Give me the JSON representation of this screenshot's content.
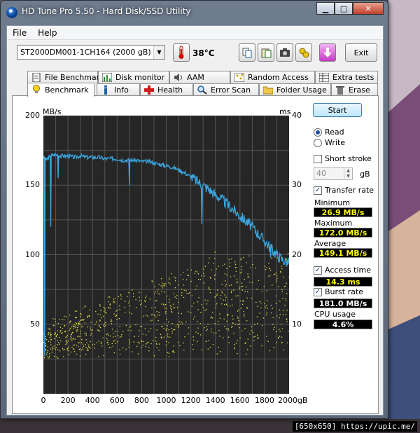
{
  "window": {
    "title": "HD Tune Pro 5.50 - Hard Disk/SSD Utility",
    "buttons": {
      "minimize": "▁",
      "maximize": "□",
      "close": "✕"
    }
  },
  "menu": {
    "file": "File",
    "help": "Help"
  },
  "toolbar": {
    "drive": "ST2000DM001-1CH164 (2000 gB)",
    "temperature": "38°C",
    "exit": "Exit"
  },
  "tabs_top": [
    "File Benchmark",
    "Disk monitor",
    "AAM",
    "Random Access",
    "Extra tests"
  ],
  "tabs_bottom": [
    "Benchmark",
    "Info",
    "Health",
    "Error Scan",
    "Folder Usage",
    "Erase"
  ],
  "side": {
    "start": "Start",
    "read": "Read",
    "write": "Write",
    "short_stroke": "Short stroke",
    "short_stroke_value": "40",
    "short_stroke_unit": "gB",
    "transfer_rate": "Transfer rate",
    "minimum_label": "Minimum",
    "minimum": "26.9 MB/s",
    "maximum_label": "Maximum",
    "maximum": "172.0 MB/s",
    "average_label": "Average",
    "average": "149.1 MB/s",
    "access_time": "Access time",
    "access_time_value": "14.3 ms",
    "burst_rate": "Burst rate",
    "burst_rate_value": "181.0 MB/s",
    "cpu_usage": "CPU usage",
    "cpu_usage_value": "4.6%"
  },
  "footer": "[650x650] https://upic.me/",
  "colors": {
    "chart_bg": "#262626",
    "transfer_line": "#3ba7e0",
    "access_dots": "#e5e54a"
  },
  "chart_data": {
    "type": "line",
    "ylabel": "MB/s",
    "y2label": "ms",
    "ylim": [
      0,
      200
    ],
    "y2lim": [
      0,
      40
    ],
    "xlim": [
      0,
      2000
    ],
    "yticks": [
      "200",
      "150",
      "100",
      "50"
    ],
    "y2ticks": [
      "40",
      "30",
      "20",
      "10"
    ],
    "xticks": [
      "0",
      "200",
      "400",
      "600",
      "800",
      "1000",
      "1200",
      "1400",
      "1600",
      "1800",
      "2000gB"
    ],
    "series": [
      {
        "x": [
          0,
          20,
          60,
          100,
          150,
          200,
          250,
          300,
          350,
          400,
          450,
          500,
          550,
          600,
          650,
          700,
          750,
          800,
          850,
          900,
          950,
          1000,
          1050,
          1100,
          1150,
          1200,
          1250,
          1300,
          1350,
          1400,
          1450,
          1500,
          1550,
          1600,
          1650,
          1700,
          1750,
          1800,
          1850,
          1900,
          1950,
          2000
        ],
        "y": [
          170,
          168,
          171,
          172,
          171,
          171,
          170,
          171,
          170,
          170,
          170,
          169,
          169,
          169,
          168,
          168,
          168,
          167,
          167,
          166,
          165,
          164,
          163,
          161,
          159,
          156,
          153,
          150,
          147,
          143,
          140,
          136,
          132,
          128,
          124,
          120,
          115,
          110,
          105,
          100,
          96,
          94
        ]
      }
    ],
    "drops": [
      {
        "x": 10,
        "y": 27
      },
      {
        "x": 60,
        "y": 120
      },
      {
        "x": 120,
        "y": 155
      },
      {
        "x": 700,
        "y": 150
      },
      {
        "x": 1290,
        "y": 122
      },
      {
        "x": 1850,
        "y": 98
      }
    ],
    "scatter_unit": "ms",
    "scatter_range_x": [
      0,
      2000
    ],
    "scatter_range_ms": [
      6,
      20
    ]
  }
}
